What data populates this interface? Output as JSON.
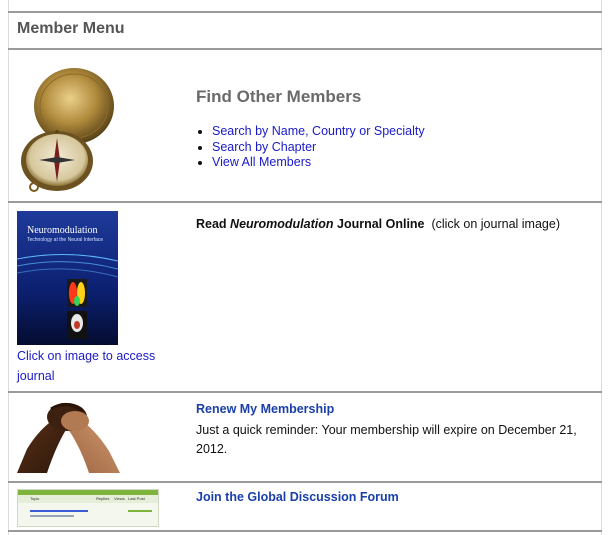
{
  "header": {
    "title": "Member Menu"
  },
  "find_members": {
    "title": "Find Other Members",
    "links": [
      "Search by Name, Country or Specialty",
      "Search by Chapter",
      "View All Members"
    ],
    "image_icon": "compass-image"
  },
  "journal": {
    "read_prefix": "Read ",
    "journal_name": "Neuromodulation",
    "read_suffix": " Journal Online",
    "click_note": "(click on journal image)",
    "cover_title": "Neuromodulation",
    "cover_subtitle": "Technology at the Neural Interface",
    "access_link": "Click on image to access journal"
  },
  "membership": {
    "renew_link": "Renew My Membership",
    "reminder_line1": "Just a quick reminder: Your membership will expire on December 21,",
    "reminder_line2": "2012.",
    "image_icon": "handshake-image"
  },
  "forum": {
    "join_link": "Join the Global Discussion Forum",
    "thumb_col_topic": "Topic",
    "thumb_col_replies": "Replies",
    "thumb_col_views": "Views",
    "thumb_col_last": "Last Post"
  },
  "colors": {
    "link": "#1a1ac8",
    "divider": "#9a9a9a",
    "heading_gray": "#6a6a6a"
  }
}
